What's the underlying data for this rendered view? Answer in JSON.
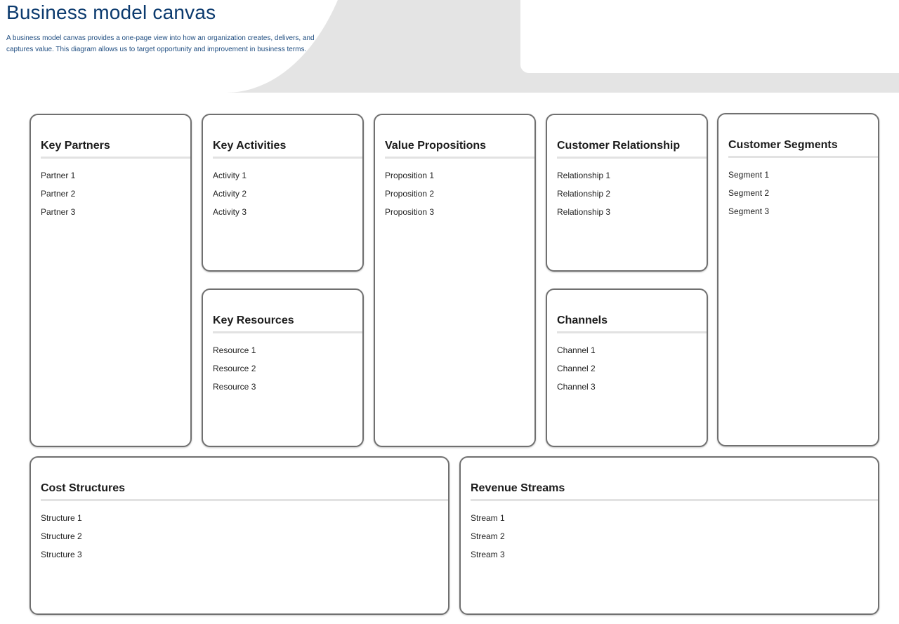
{
  "header": {
    "title": "Business model canvas",
    "description": "A business model canvas provides a one-page view into how an organization creates, delivers, and captures value. This diagram allows us to target opportunity and improvement in business terms."
  },
  "canvas": {
    "key_partners": {
      "title": "Key Partners",
      "items": [
        "Partner 1",
        "Partner 2",
        "Partner 3"
      ]
    },
    "key_activities": {
      "title": "Key Activities",
      "items": [
        "Activity 1",
        "Activity 2",
        "Activity 3"
      ]
    },
    "key_resources": {
      "title": "Key Resources",
      "items": [
        "Resource 1",
        "Resource 2",
        "Resource 3"
      ]
    },
    "value_propositions": {
      "title": "Value Propositions",
      "items": [
        "Proposition 1",
        "Proposition 2",
        "Proposition 3"
      ]
    },
    "customer_relationship": {
      "title": "Customer Relationship",
      "items": [
        "Relationship 1",
        "Relationship 2",
        "Relationship 3"
      ]
    },
    "channels": {
      "title": "Channels",
      "items": [
        "Channel 1",
        "Channel 2",
        "Channel 3"
      ]
    },
    "customer_segments": {
      "title": "Customer Segments",
      "items": [
        "Segment 1",
        "Segment 2",
        "Segment 3"
      ]
    },
    "cost_structures": {
      "title": "Cost Structures",
      "items": [
        "Structure 1",
        "Structure 2",
        "Structure 3"
      ]
    },
    "revenue_streams": {
      "title": "Revenue Streams",
      "items": [
        "Stream 1",
        "Stream 2",
        "Stream 3"
      ]
    }
  },
  "colors": {
    "title": "#0b3a6e",
    "description": "#1f4d80",
    "box_border": "#707070",
    "header_band": "#e4e4e4"
  }
}
